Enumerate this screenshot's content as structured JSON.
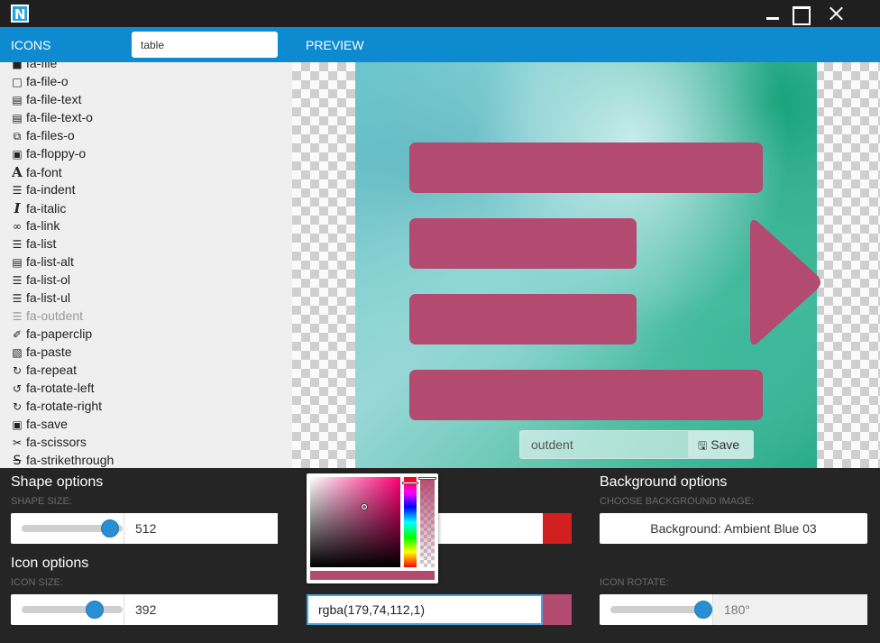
{
  "titlebar": {
    "logo": "N"
  },
  "header": {
    "icons_label": "ICONS",
    "search_value": "table",
    "preview_label": "PREVIEW"
  },
  "icon_list": [
    {
      "glyph": "file-icon",
      "label": "fa-file"
    },
    {
      "glyph": "file-o-icon",
      "label": "fa-file-o"
    },
    {
      "glyph": "file-text-icon",
      "label": "fa-file-text"
    },
    {
      "glyph": "file-text-o-icon",
      "label": "fa-file-text-o"
    },
    {
      "glyph": "files-o-icon",
      "label": "fa-files-o"
    },
    {
      "glyph": "floppy-o-icon",
      "label": "fa-floppy-o"
    },
    {
      "glyph": "font-icon",
      "label": "fa-font"
    },
    {
      "glyph": "indent-icon",
      "label": "fa-indent"
    },
    {
      "glyph": "italic-icon",
      "label": "fa-italic"
    },
    {
      "glyph": "link-icon",
      "label": "fa-link"
    },
    {
      "glyph": "list-icon",
      "label": "fa-list"
    },
    {
      "glyph": "list-alt-icon",
      "label": "fa-list-alt"
    },
    {
      "glyph": "list-ol-icon",
      "label": "fa-list-ol"
    },
    {
      "glyph": "list-ul-icon",
      "label": "fa-list-ul"
    },
    {
      "glyph": "outdent-icon",
      "label": "fa-outdent"
    },
    {
      "glyph": "paperclip-icon",
      "label": "fa-paperclip"
    },
    {
      "glyph": "paste-icon",
      "label": "fa-paste"
    },
    {
      "glyph": "repeat-icon",
      "label": "fa-repeat"
    },
    {
      "glyph": "rotate-left-icon",
      "label": "fa-rotate-left"
    },
    {
      "glyph": "rotate-right-icon",
      "label": "fa-rotate-right"
    },
    {
      "glyph": "save-icon",
      "label": "fa-save"
    },
    {
      "glyph": "scissors-icon",
      "label": "fa-scissors"
    },
    {
      "glyph": "strikethrough-icon",
      "label": "fa-strikethrough"
    }
  ],
  "preview": {
    "icon_name_value": "outdent",
    "save_label": "Save",
    "icon_color": "#b34a70"
  },
  "shape_options": {
    "title": "Shape options",
    "size_label": "SHAPE SIZE:",
    "size_value": "512",
    "size_level": 0.95,
    "color_swatch": "#d22020"
  },
  "icon_options": {
    "title": "Icon options",
    "size_label": "ICON SIZE:",
    "size_value": "392",
    "size_level": 0.76,
    "color_value": "rgba(179,74,112,1)"
  },
  "background_options": {
    "title": "Background options",
    "image_label": "CHOOSE BACKGROUND IMAGE:",
    "image_value": "Background: Ambient Blue 03",
    "rotate_label": "ICON ROTATE:",
    "rotate_value": "180°",
    "rotate_level": 1.0
  }
}
